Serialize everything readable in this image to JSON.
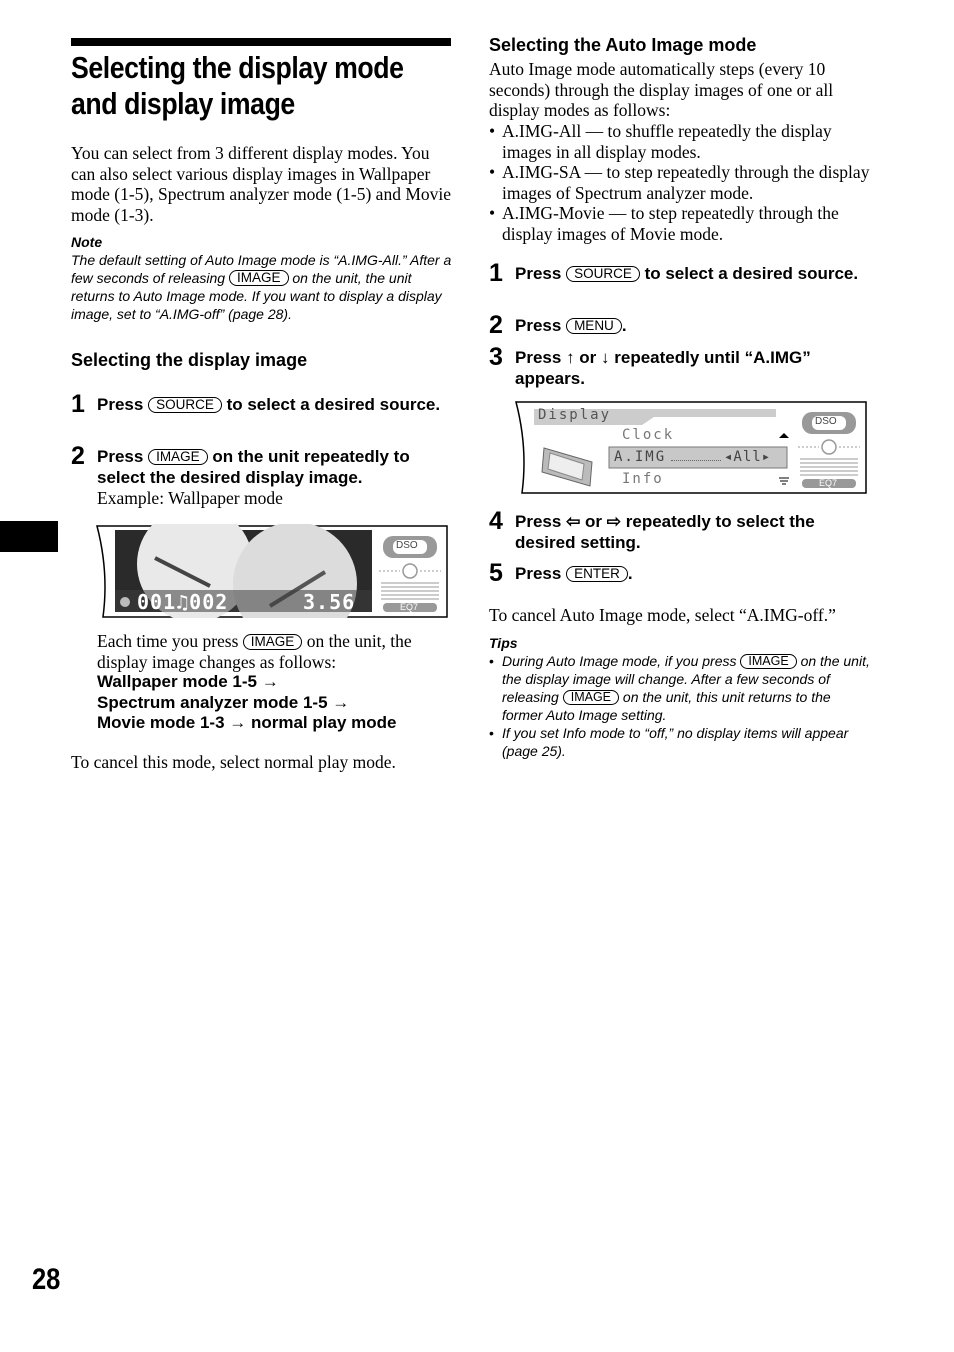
{
  "page": {
    "number": "28",
    "title": "Selecting the display mode and display image"
  },
  "left": {
    "intro": "You can select from 3 different display modes. You can also select various display images in Wallpaper mode (1-5), Spectrum analyzer mode (1-5) and Movie mode (1-3).",
    "note": {
      "heading": "Note",
      "line1": "The default setting of Auto Image mode is “A.IMG-All.” After a few seconds of releasing",
      "key": "IMAGE",
      "line2": "on the unit, the unit returns to Auto Image mode. If you want to display a display image, set to “A.IMG-off” (page 28)."
    },
    "section_heading": "Selecting the display image",
    "steps": [
      {
        "num": "1",
        "before": "Press",
        "key": "SOURCE",
        "after": "to select a desired source."
      },
      {
        "num": "2",
        "before": "Press",
        "key": "IMAGE",
        "after": "on the unit repeatedly to select the desired display image.",
        "sub": "Example: Wallpaper mode"
      }
    ],
    "display": {
      "counter": "001♫002",
      "time": "3.56",
      "dso_label": "DSO",
      "eq_label": "EQ7"
    },
    "each_time": {
      "before": "Each time you press",
      "key": "IMAGE",
      "after": "on the unit, the display image changes as follows:",
      "chain": [
        "Wallpaper mode 1-5 →",
        "Spectrum analyzer mode 1-5 →",
        "Movie mode 1-3 → normal play mode"
      ]
    },
    "cancel": "To cancel this mode, select normal play mode."
  },
  "right": {
    "section_heading": "Selecting the Auto Image mode",
    "intro": "Auto Image mode automatically steps (every 10 seconds) through the display images of one or all display modes as follows:",
    "bullets": [
      "A.IMG-All — to shuffle repeatedly the display images in all display modes.",
      "A.IMG-SA — to step repeatedly through the display images of Spectrum analyzer mode.",
      "A.IMG-Movie — to step repeatedly through the display images of Movie mode."
    ],
    "steps": [
      {
        "num": "1",
        "before": "Press",
        "key": "SOURCE",
        "after": "to select a desired source."
      },
      {
        "num": "2",
        "before": "Press",
        "key": "MENU",
        "after": "."
      },
      {
        "num": "3",
        "before": "Press",
        "up": "↑",
        "or": "or",
        "down": "↓",
        "after": "repeatedly until “A.IMG” appears."
      },
      {
        "num": "4",
        "before": "Press",
        "left": "⇦",
        "or": "or",
        "right": "⇨",
        "after": "repeatedly to select the desired setting."
      },
      {
        "num": "5",
        "before": "Press",
        "key": "ENTER",
        "after": "."
      }
    ],
    "display": {
      "header": "Display",
      "row_above": "Clock",
      "row_selected": "A.IMG",
      "row_selected_value": "◂All▸",
      "row_below": "Info",
      "dso_label": "DSO",
      "eq_label": "EQ7"
    },
    "cancel": "To cancel Auto Image mode, select “A.IMG-off.”",
    "tips": {
      "heading": "Tips",
      "tip1_a": "During Auto Image mode, if you press",
      "tip1_key1": "IMAGE",
      "tip1_b": "on the unit, the display image will change. After a few seconds of releasing",
      "tip1_key2": "IMAGE",
      "tip1_c": "on the unit, this unit returns to the former Auto Image setting.",
      "tip2": "If you set Info mode to “off,” no display items will appear (page 25)."
    }
  }
}
